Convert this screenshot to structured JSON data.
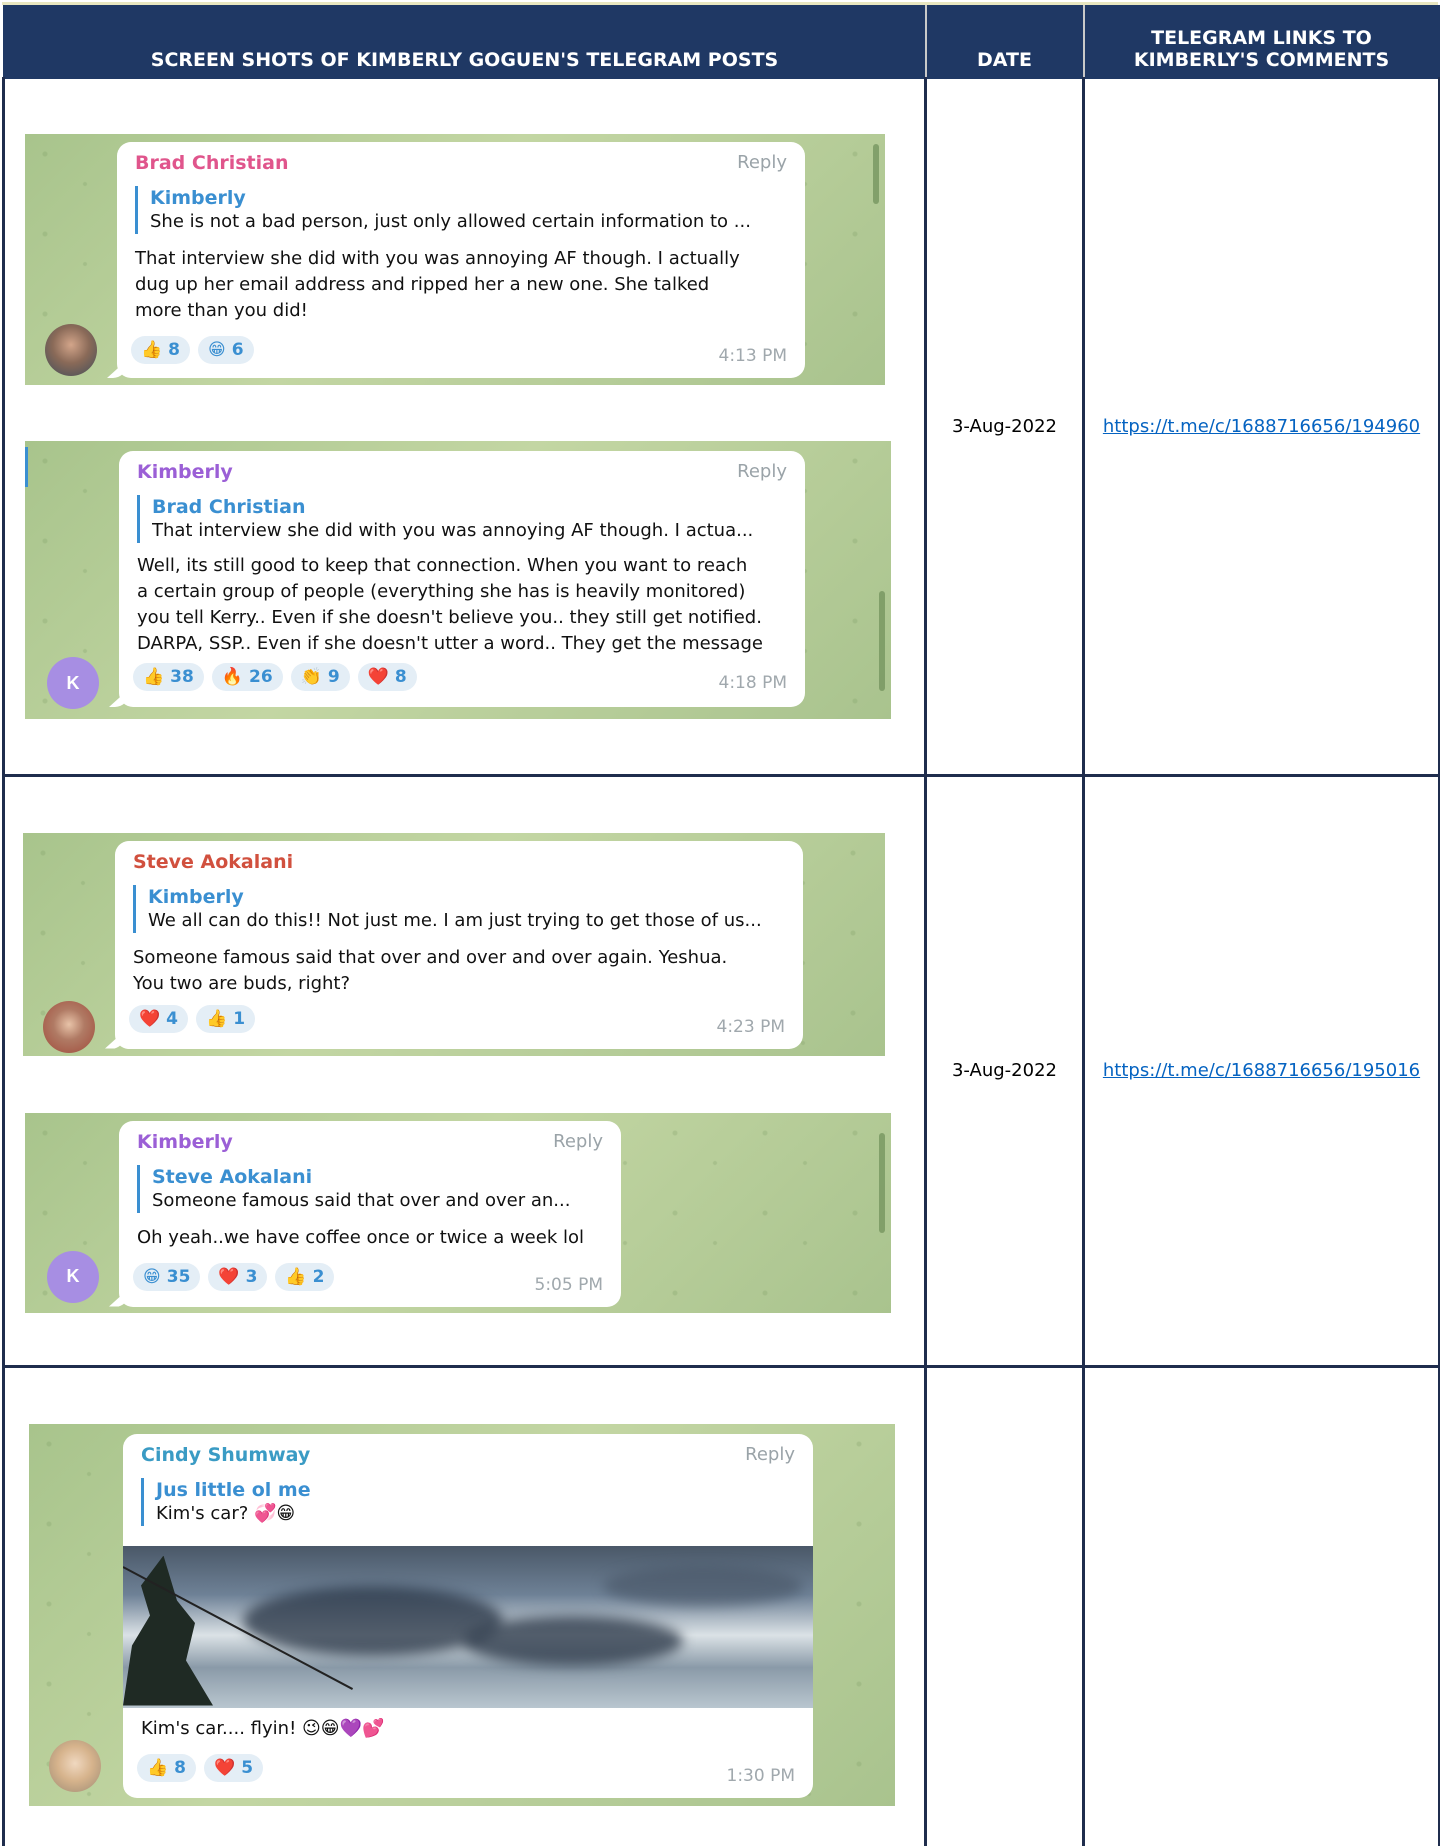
{
  "headers": {
    "screenshots": "SCREEN SHOTS OF KIMBERLY GOGUEN'S TELEGRAM POSTS",
    "date": "DATE",
    "links": "TELEGRAM LINKS TO KIMBERLY'S COMMENTS"
  },
  "rows": [
    {
      "date": "3-Aug-2022",
      "link": "https://t.me/c/1688716656/194960",
      "messages": [
        {
          "sender": "Brad Christian",
          "sender_color": "#e0558c",
          "reply_label": "Reply",
          "quote_name": "Kimberly",
          "quote_text": "She is not a bad person, just only allowed certain information to ...",
          "text_lines": [
            "That interview she did with you was annoying AF though.  I actually",
            "dug up her email address and ripped her a new one.  She talked",
            "more than you did!"
          ],
          "reactions": [
            {
              "emoji": "👍",
              "count": "8"
            },
            {
              "emoji": "😁",
              "count": "6"
            }
          ],
          "time": "4:13 PM"
        },
        {
          "sender": "Kimberly",
          "sender_color": "#9b5fd6",
          "avatar_letter": "K",
          "reply_label": "Reply",
          "quote_name": "Brad Christian",
          "quote_text": "That interview she did with you was annoying AF though.  I actua...",
          "text_lines": [
            "Well, its still good to keep that connection. When you want to reach",
            "a certain group of people (everything she has is heavily monitored)",
            "you tell Kerry.. Even if she doesn't believe you.. they still get notified.",
            "DARPA, SSP.. Even if she doesn't utter a word.. They get the message"
          ],
          "reactions": [
            {
              "emoji": "👍",
              "count": "38"
            },
            {
              "emoji": "🔥",
              "count": "26"
            },
            {
              "emoji": "👏",
              "count": "9"
            },
            {
              "emoji": "❤️",
              "count": "8"
            }
          ],
          "time": "4:18 PM"
        }
      ]
    },
    {
      "date": "3-Aug-2022",
      "link": "https://t.me/c/1688716656/195016",
      "messages": [
        {
          "sender": "Steve Aokalani",
          "sender_color": "#d1503e",
          "quote_name": "Kimberly",
          "quote_text": "We all can do this!! Not just me. I am just trying to get those of us...",
          "text_lines": [
            "Someone famous said that over and over and over again.  Yeshua.",
            "You two are buds, right?"
          ],
          "reactions": [
            {
              "emoji": "❤️",
              "count": "4"
            },
            {
              "emoji": "👍",
              "count": "1"
            }
          ],
          "time": "4:23 PM"
        },
        {
          "sender": "Kimberly",
          "sender_color": "#9b5fd6",
          "avatar_letter": "K",
          "reply_label": "Reply",
          "quote_name": "Steve Aokalani",
          "quote_text": "Someone famous said that over and over an...",
          "text_lines": [
            "Oh yeah..we have coffee once or twice a week lol"
          ],
          "reactions": [
            {
              "emoji": "😁",
              "count": "35"
            },
            {
              "emoji": "❤️",
              "count": "3"
            },
            {
              "emoji": "👍",
              "count": "2"
            }
          ],
          "time": "5:05 PM"
        }
      ]
    },
    {
      "date": "",
      "link": "",
      "messages": [
        {
          "sender": "Cindy Shumway",
          "sender_color": "#3a9bc4",
          "reply_label": "Reply",
          "quote_name": "Jus little ol me",
          "quote_text": "Kim's car? 💞😁",
          "text_lines": [
            "Kim's car.... flyin! 😉😁💜💕"
          ],
          "reactions": [
            {
              "emoji": "👍",
              "count": "8"
            },
            {
              "emoji": "❤️",
              "count": "5"
            }
          ],
          "time": "1:30 PM"
        }
      ]
    }
  ]
}
